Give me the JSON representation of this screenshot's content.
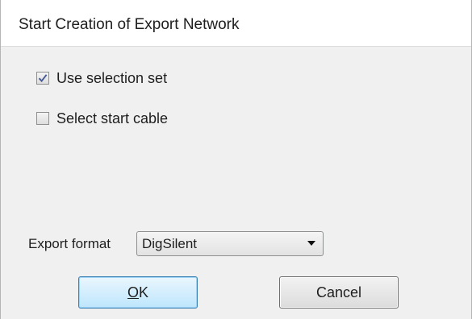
{
  "window": {
    "title": "Start Creation of Export Network"
  },
  "options": {
    "use_selection_set": {
      "label": "Use selection set",
      "checked": true
    },
    "select_start_cable": {
      "label": "Select start cable",
      "checked": false
    }
  },
  "export": {
    "label": "Export format",
    "selected": "DigSilent"
  },
  "buttons": {
    "ok_mnemonic": "O",
    "ok_rest": "K",
    "cancel": "Cancel"
  },
  "icons": {
    "checkmark": "checkmark-icon",
    "dropdown": "chevron-down-icon"
  },
  "colors": {
    "title_bg": "#ffffff",
    "dialog_bg": "#f0f0f0",
    "default_button_border": "#3c7fb1",
    "check_color": "#4a5f97"
  }
}
